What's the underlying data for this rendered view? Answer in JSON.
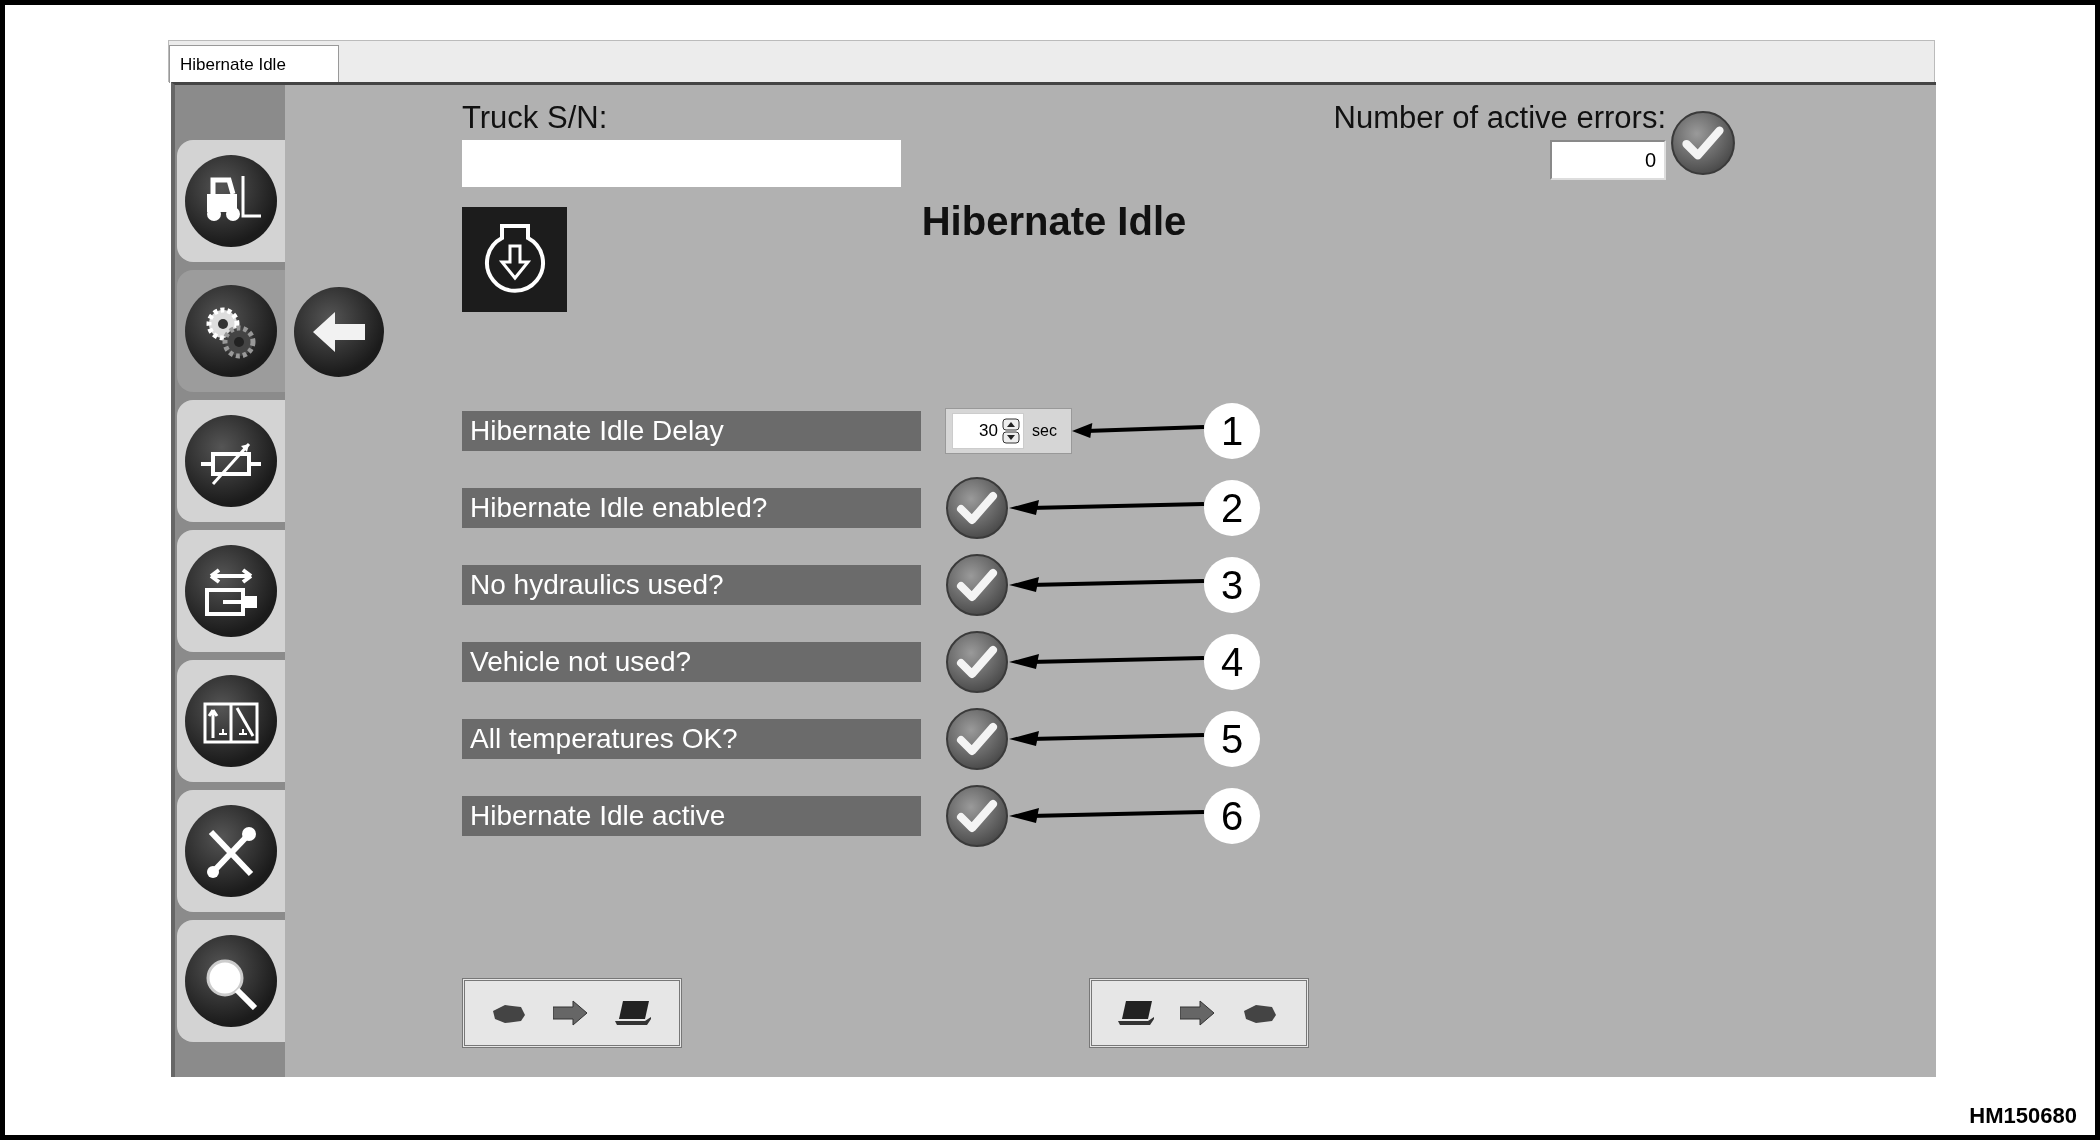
{
  "tab": {
    "label": "Hibernate Idle",
    "selected": true
  },
  "sidebar": {
    "items": [
      {
        "kind": "forklift",
        "selected": false
      },
      {
        "kind": "gears",
        "selected": true
      },
      {
        "kind": "resistor",
        "selected": false
      },
      {
        "kind": "cylinder",
        "selected": false
      },
      {
        "kind": "valve",
        "selected": false
      },
      {
        "kind": "tools",
        "selected": false
      },
      {
        "kind": "search",
        "selected": false
      }
    ]
  },
  "truck_sn": {
    "label": "Truck S/N:"
  },
  "active_errors": {
    "label": "Number of active errors:",
    "value": "0",
    "ok": true
  },
  "title": "Hibernate Idle",
  "rows": [
    {
      "kind": "spinner",
      "label": "Hibernate Idle Delay",
      "value": "30",
      "unit": "sec",
      "callout": "1"
    },
    {
      "kind": "check",
      "label": "Hibernate Idle enabled?",
      "checked": true,
      "callout": "2"
    },
    {
      "kind": "check",
      "label": "No hydraulics used?",
      "checked": true,
      "callout": "3"
    },
    {
      "kind": "check",
      "label": "Vehicle not used?",
      "checked": true,
      "callout": "4"
    },
    {
      "kind": "check",
      "label": "All temperatures OK?",
      "checked": true,
      "callout": "5"
    },
    {
      "kind": "check",
      "label": "Hibernate Idle active",
      "checked": true,
      "callout": "6"
    }
  ],
  "transfer_buttons": [
    {
      "kind": "upload"
    },
    {
      "kind": "download"
    }
  ],
  "figure_id": "HM150680"
}
